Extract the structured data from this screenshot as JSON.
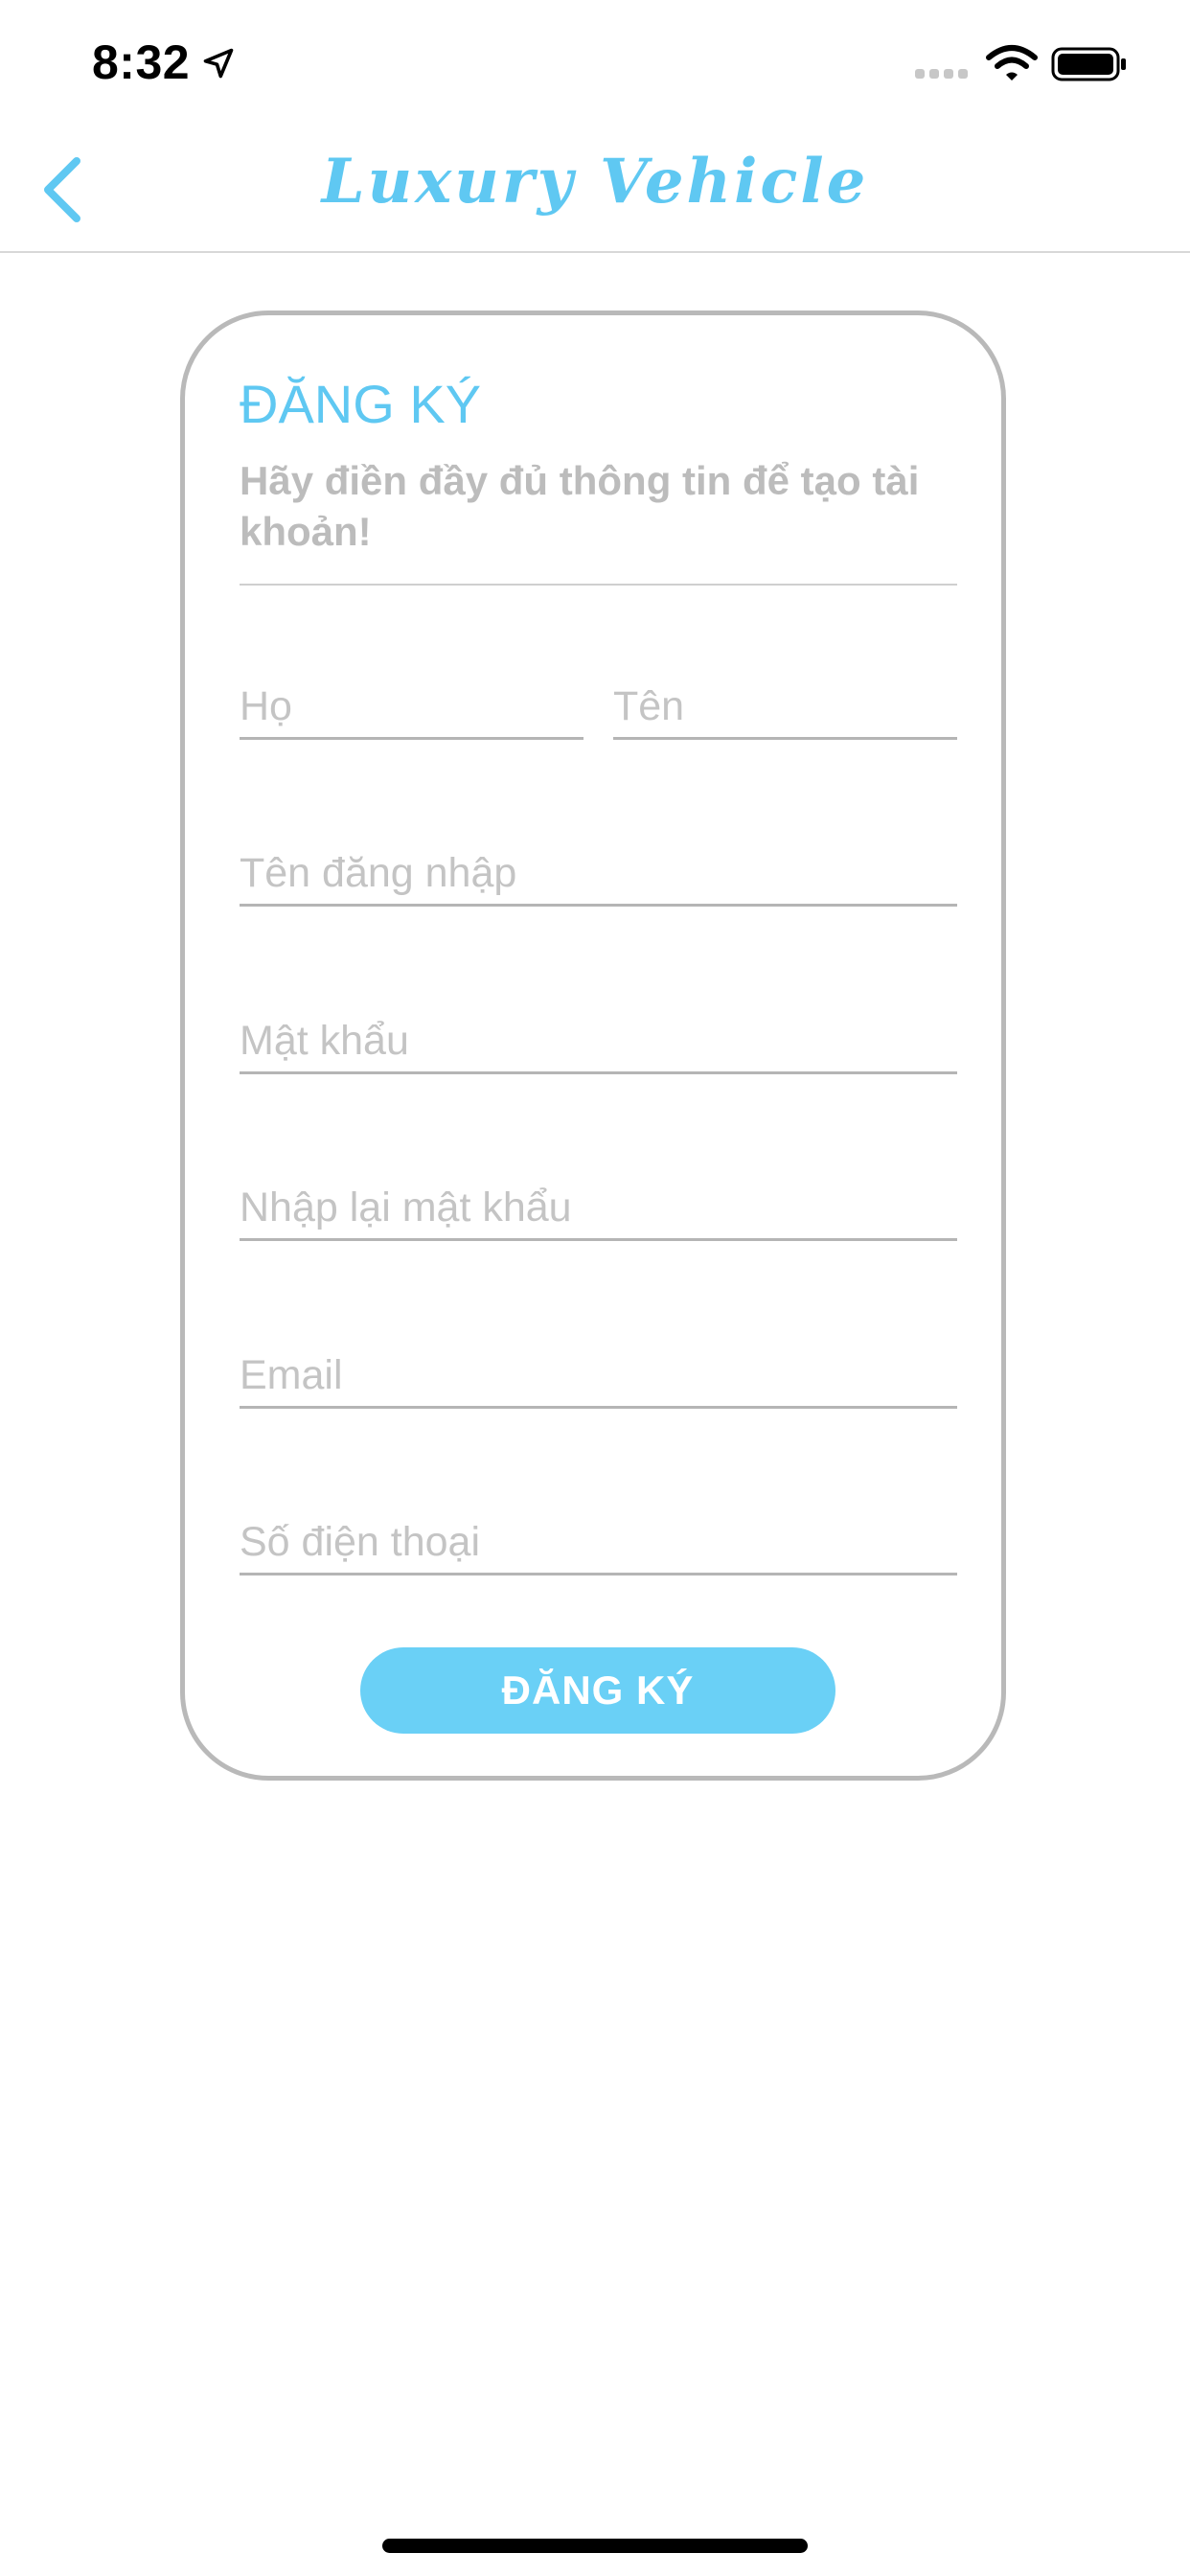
{
  "status_bar": {
    "time": "8:32",
    "icons": [
      "location-arrow-icon",
      "signal-dots-icon",
      "wifi-icon",
      "battery-icon"
    ]
  },
  "nav": {
    "title": "Luxury Vehicle",
    "back_icon": "chevron-left-icon",
    "accent_color": "#5fc8f2"
  },
  "form": {
    "heading": "ĐĂNG KÝ",
    "subtitle": "Hãy điền đầy đủ thông tin để tạo tài khoản!",
    "fields": {
      "last_name": {
        "placeholder": "Họ",
        "value": ""
      },
      "first_name": {
        "placeholder": "Tên",
        "value": ""
      },
      "username": {
        "placeholder": "Tên đăng nhập",
        "value": ""
      },
      "password": {
        "placeholder": "Mật khẩu",
        "value": ""
      },
      "confirm_password": {
        "placeholder": "Nhập lại mật khẩu",
        "value": ""
      },
      "email": {
        "placeholder": "Email",
        "value": ""
      },
      "phone": {
        "placeholder": "Số điện thoại",
        "value": ""
      }
    },
    "submit_label": "ĐĂNG KÝ",
    "button_color": "#6ad0f6"
  }
}
